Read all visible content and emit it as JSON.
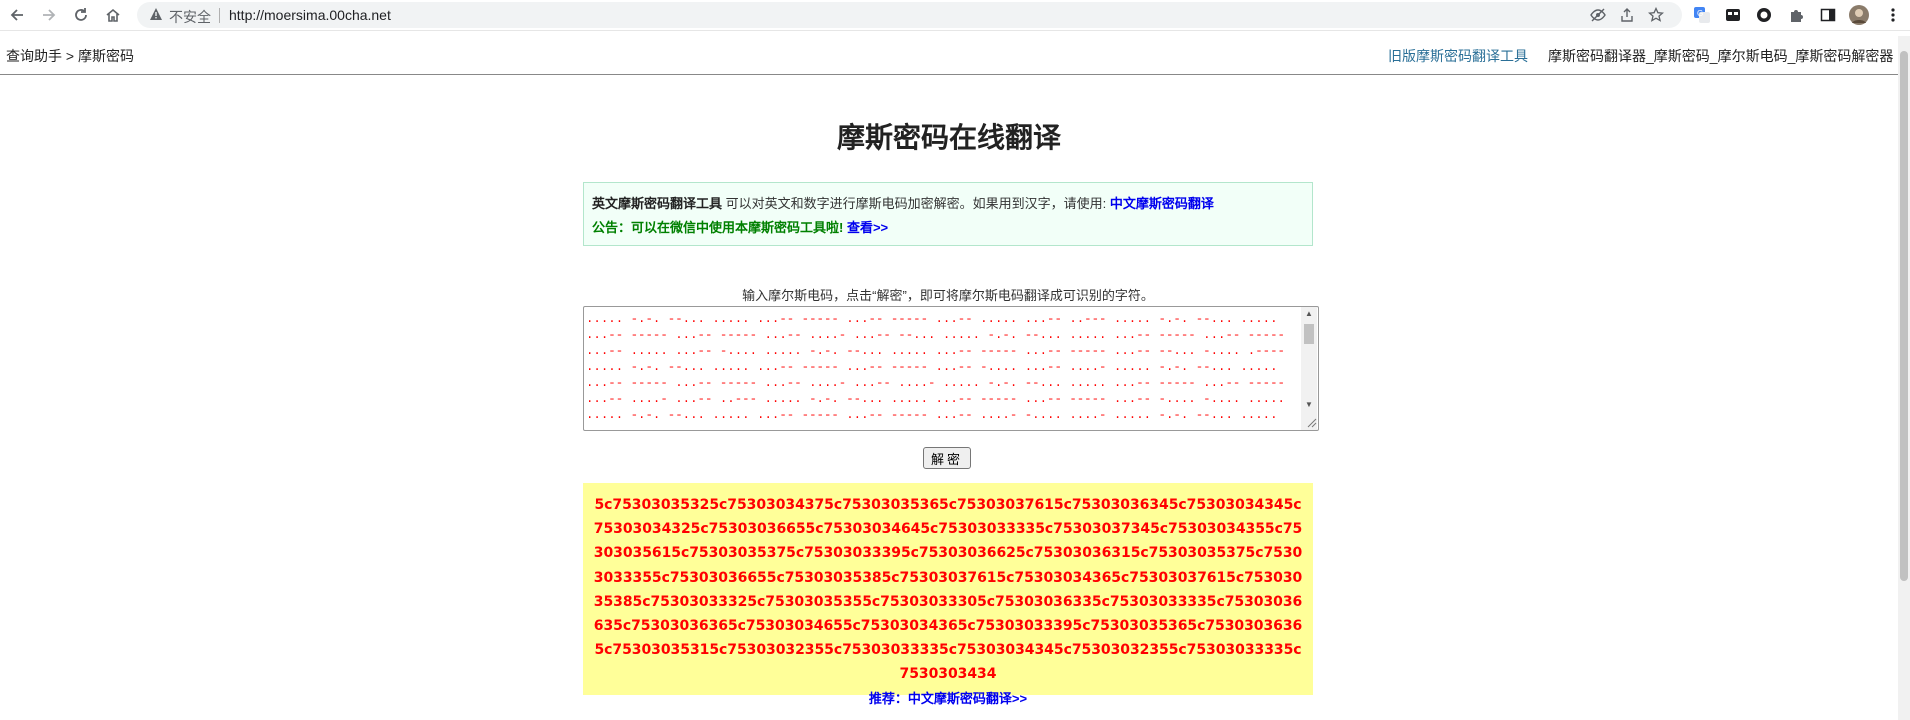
{
  "browser": {
    "insecure_label": "不安全",
    "url": "http://moersima.00cha.net"
  },
  "header": {
    "breadcrumb_home": "查询助手",
    "breadcrumb_sep": ">",
    "breadcrumb_current": "摩斯密码",
    "old_tool_link": "旧版摩斯密码翻译工具",
    "keywords": "摩斯密码翻译器_摩斯密码_摩尔斯电码_摩斯密码解密器"
  },
  "page": {
    "title": "摩斯密码在线翻译"
  },
  "notice": {
    "tool_name": "英文摩斯密码翻译工具",
    "description": "可以对英文和数字进行摩斯电码加密解密。如果用到汉字，请使用:",
    "chinese_tool_link": "中文摩斯密码翻译",
    "announcement": "公告：可以在微信中使用本摩斯密码工具啦!",
    "view_link": "查看>>"
  },
  "instruction": "输入摩尔斯电码，点击“解密”，即可将摩尔斯电码翻译成可识别的字符。",
  "morse_input": {
    "value": "..... -.-. --... ..... ...-- ----- ...-- ----- ...-- ..... ...-- ..--- ..... -.-. --... ..... ...-- ----- ...-- ----- ...-- ....- ...-- --... ..... -.-. --... ..... ...-- ----- ...-- ----- ...-- ..... ...-- -.... ..... -.-. --... ..... ...-- ----- ...-- ----- ...-- --... -.... .---- ..... -.-. --... ..... ...-- ----- ...-- ----- ...-- -.... ...-- ....- ..... -.-. --... ..... ...-- ----- ...-- ----- ...-- ....- ...-- ....- ..... -.-. --... ..... ...-- ----- ...-- ----- ...-- ....- ...-- ..--- ..... -.-. --... ..... ...-- ----- ...-- ----- ...-- -.... -.... ..... ..... -.-. --... ..... ...-- ----- ...-- ----- ...-- ....- -.... ....- ..... -.-. --... ..... ...-- ----- ...-- ----- ...-- ...-- ...-- ...-- ..... -.-. --... ..... ...-- ----- ...-- ----- ...-- --... ...-- ....- ..... -.-. --... ..... ...-- ----- ...-- ----- ...-- ....- ...-- ..... ..... -.-. --... ..... ...-- ----- ...-- ----- ...-- ..... -.... .---- ..... -.-. --... ..... ...-- ----- ...-- -----"
  },
  "decode_button": "解密",
  "result": {
    "text": "5c75303035325c75303034375c75303035365c75303037615c75303036345c75303034345c75303034325c75303036655c75303034645c75303033335c75303037345c75303034355c75303035615c75303035375c75303033395c75303036625c75303036315c75303035375c75303033355c75303036655c75303035385c75303037615c75303034365c75303037615c75303035385c75303033325c75303035355c75303033305c75303036335c75303033335c75303036635c75303036365c75303034655c75303034365c75303033395c75303035365c75303036365c75303035315c75303032355c75303033335c75303034345c75303032355c75303033335c7530303434",
    "recommend_prefix": "推荐：",
    "recommend_link": "中文摩斯密码翻译>>"
  }
}
